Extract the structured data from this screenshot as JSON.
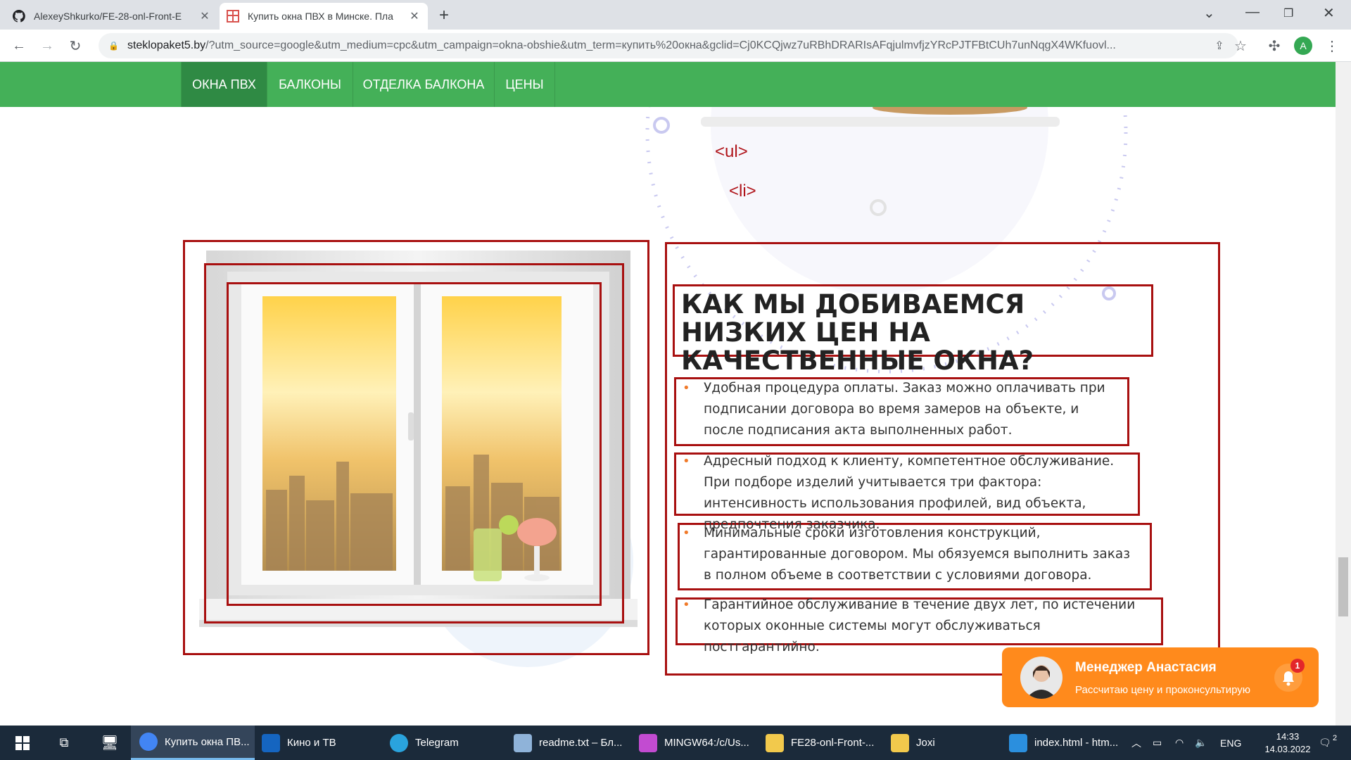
{
  "browser": {
    "tabs": [
      {
        "title": "AlexeyShkurko/FE-28-onl-Front-E",
        "active": false
      },
      {
        "title": "Купить окна ПВХ в Минске. Пла",
        "active": true
      }
    ],
    "url_domain": "steklopaket5.by",
    "url_rest": "/?utm_source=google&utm_medium=cpc&utm_campaign=okna-obshie&utm_term=купить%20окна&gclid=Cj0KCQjwz7uRBhDRARIsAFqjulmvfjzYRcPJTFBtCUh7unNqgX4WKfuovl...",
    "profile_initial": "A"
  },
  "site": {
    "nav": [
      {
        "label": "ОКНА ПВХ",
        "active": true
      },
      {
        "label": "БАЛКОНЫ",
        "active": false
      },
      {
        "label": "ОТДЕЛКА БАЛКОНА",
        "active": false
      },
      {
        "label": "ЦЕНЫ",
        "active": false
      }
    ],
    "code_tags": [
      "<ul>",
      "<li>"
    ],
    "heading": "КАК МЫ ДОБИВАЕМСЯ НИЗКИХ ЦЕН НА КАЧЕСТВЕННЫЕ ОКНА?",
    "items": [
      "Удобная процедура оплаты. Заказ можно оплачивать при подписании договора во время замеров на объекте, и после подписания акта выполненных работ.",
      "Адресный подход к клиенту, компетентное обслуживание. При подборе изделий учитывается три фактора: интенсивность использования профилей, вид объекта, предпочтения заказчика.",
      "Минимальные сроки изготовления конструкций, гарантированные договором. Мы обязуемся выполнить заказ в полном объеме в соответствии с условиями договора.",
      "Гарантийное обслуживание в течение двух лет, по истечении которых оконные системы могут обслуживаться постгарантийно."
    ],
    "chat": {
      "name": "Менеджер Анастасия",
      "subtitle": "Рассчитаю цену и проконсультирую",
      "badge": "1"
    }
  },
  "taskbar": {
    "items": [
      {
        "label": "Купить окна ПВ...",
        "color": "#4285f4"
      },
      {
        "label": "Кино и ТВ",
        "color": "#1565c0"
      },
      {
        "label": "Telegram",
        "color": "#2aa3dd"
      },
      {
        "label": "readme.txt – Бл...",
        "color": "#8fb3d9"
      },
      {
        "label": "MINGW64:/c/Us...",
        "color": "#c24bd1"
      },
      {
        "label": "FE28-onl-Front-...",
        "color": "#f2c94c"
      },
      {
        "label": "Joxi",
        "color": "#f2c94c"
      },
      {
        "label": "index.html - htm...",
        "color": "#2b8fde"
      }
    ],
    "lang": "ENG",
    "time": "14:33",
    "date": "14.03.2022",
    "notif_count": "2"
  }
}
